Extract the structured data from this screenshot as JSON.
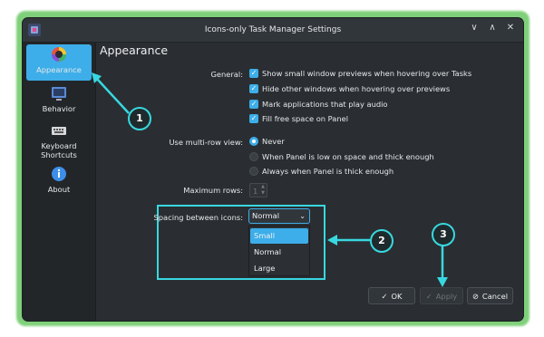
{
  "window": {
    "title": "Icons-only Task Manager Settings",
    "controls": [
      "∨",
      "∧",
      "✕"
    ]
  },
  "sidebar": {
    "items": [
      {
        "label": "Appearance",
        "icon": "color-wheel-icon",
        "active": true
      },
      {
        "label": "Behavior",
        "icon": "monitor-icon",
        "active": false
      },
      {
        "label": "Keyboard Shortcuts",
        "icon": "keyboard-icon",
        "active": false
      },
      {
        "label": "About",
        "icon": "info-icon",
        "active": false
      }
    ]
  },
  "content": {
    "heading": "Appearance",
    "general_label": "General:",
    "general_options": [
      {
        "label": "Show small window previews when hovering over Tasks",
        "checked": true
      },
      {
        "label": "Hide other windows when hovering over previews",
        "checked": true
      },
      {
        "label": "Mark applications that play audio",
        "checked": true
      },
      {
        "label": "Fill free space on Panel",
        "checked": true
      }
    ],
    "multirow_label": "Use multi-row view:",
    "multirow_options": [
      {
        "label": "Never",
        "selected": true
      },
      {
        "label": "When Panel is low on space and thick enough",
        "selected": false
      },
      {
        "label": "Always when Panel is thick enough",
        "selected": false
      }
    ],
    "max_rows_label": "Maximum rows:",
    "max_rows_value": "1",
    "spacing_label": "Spacing between icons:",
    "spacing_value": "Normal",
    "spacing_options": [
      "Small",
      "Normal",
      "Large"
    ],
    "spacing_highlighted": "Small"
  },
  "buttons": {
    "ok": "OK",
    "apply": "Apply",
    "cancel": "Cancel"
  },
  "callouts": [
    "1",
    "2",
    "3"
  ],
  "colors": {
    "accent": "#3daee9",
    "annotation": "#38d8e0",
    "frame_glow": "#7fd07a",
    "window_bg": "#2a2e32"
  }
}
